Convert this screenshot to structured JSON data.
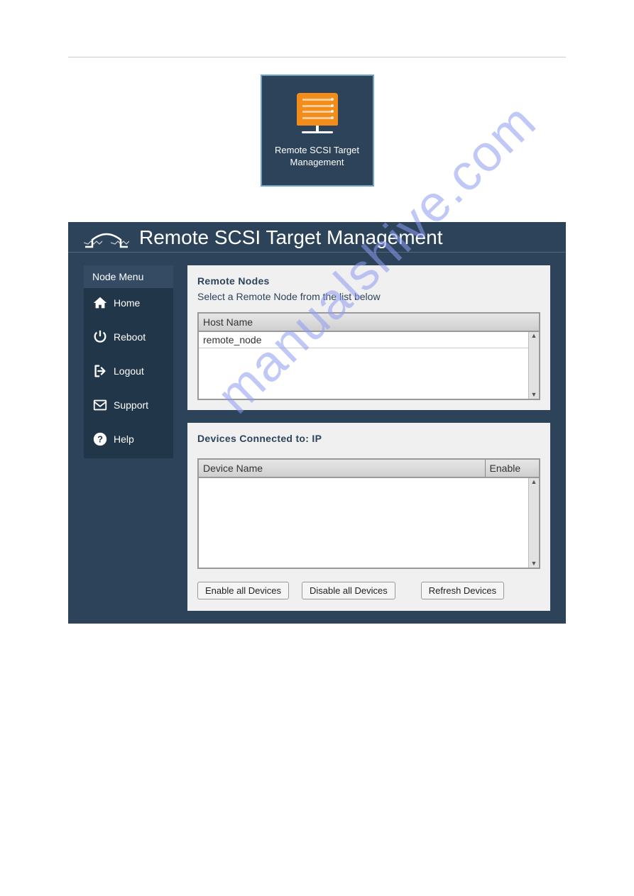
{
  "tile": {
    "label": "Remote SCSI Target Management"
  },
  "header": {
    "title": "Remote SCSI Target Management"
  },
  "sidebar": {
    "title": "Node Menu",
    "items": [
      {
        "label": "Home"
      },
      {
        "label": "Reboot"
      },
      {
        "label": "Logout"
      },
      {
        "label": "Support"
      },
      {
        "label": "Help"
      }
    ]
  },
  "remote_nodes": {
    "title": "Remote Nodes",
    "subtitle": "Select a Remote Node from the list below",
    "header_col": "Host Name",
    "rows": [
      "remote_node"
    ]
  },
  "devices": {
    "title": "Devices Connected to: IP",
    "columns": [
      "Device Name",
      "Enable"
    ]
  },
  "buttons": {
    "enable_all": "Enable all Devices",
    "disable_all": "Disable all Devices",
    "refresh": "Refresh Devices"
  },
  "watermark": "manualshive.com"
}
